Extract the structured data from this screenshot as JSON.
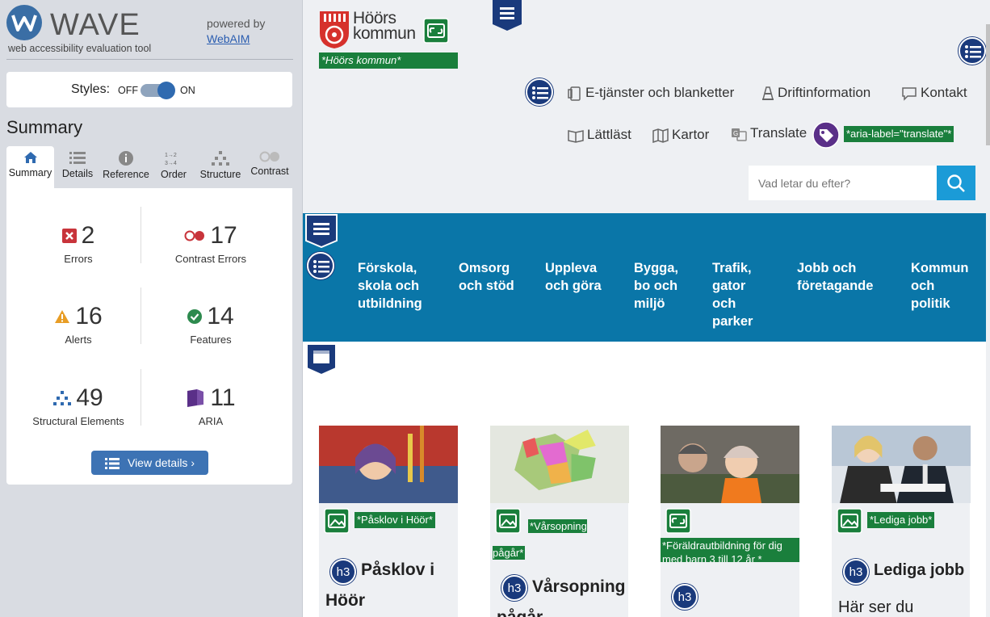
{
  "wave": {
    "logo_text": "WAVE",
    "subtitle": "web accessibility evaluation tool",
    "powered_by": "powered by",
    "webaim_link": "WebAIM",
    "styles_label": "Styles:",
    "styles_off": "OFF",
    "styles_on": "ON",
    "summary_heading": "Summary",
    "tabs": [
      "Summary",
      "Details",
      "Reference",
      "Order",
      "Structure",
      "Contrast"
    ],
    "stats": {
      "errors": {
        "value": "2",
        "label": "Errors"
      },
      "contrast": {
        "value": "17",
        "label": "Contrast Errors"
      },
      "alerts": {
        "value": "16",
        "label": "Alerts"
      },
      "features": {
        "value": "14",
        "label": "Features"
      },
      "structural": {
        "value": "49",
        "label": "Structural Elements"
      },
      "aria": {
        "value": "11",
        "label": "ARIA"
      }
    },
    "view_details": "View details ›"
  },
  "site": {
    "logo_line1": "Höörs",
    "logo_line2": "kommun",
    "logo_alt_chip": "*Höörs kommun*",
    "util_links": [
      "E-tjänster och blanketter",
      "Driftinformation",
      "Kontakt"
    ],
    "lattlast": "Lättläst",
    "kartor": "Kartor",
    "translate": "Translate",
    "aria_chip": "*aria-label=\"translate\"*",
    "search_placeholder": "Vad letar du efter?",
    "main_nav": [
      "Förskola, skola och utbildning",
      "Omsorg och stöd",
      "Uppleva och göra",
      "Bygga, bo och miljö",
      "Trafik, gator och parker",
      "Jobb och företagande",
      "Kommun och politik"
    ],
    "cards": [
      {
        "chip": "*Påsklov i Höör*",
        "title": "Påsklov i Höör"
      },
      {
        "chip": "*Vårsopning pågår*",
        "title": "Vårsopning pågår"
      },
      {
        "chip": "*Föräldrautbildning för dig med barn 3 till 12 år *",
        "title": ""
      },
      {
        "chip": "*Lediga jobb*",
        "title": "Lediga jobb",
        "text": "Här ser du"
      }
    ],
    "h3": "h3"
  }
}
